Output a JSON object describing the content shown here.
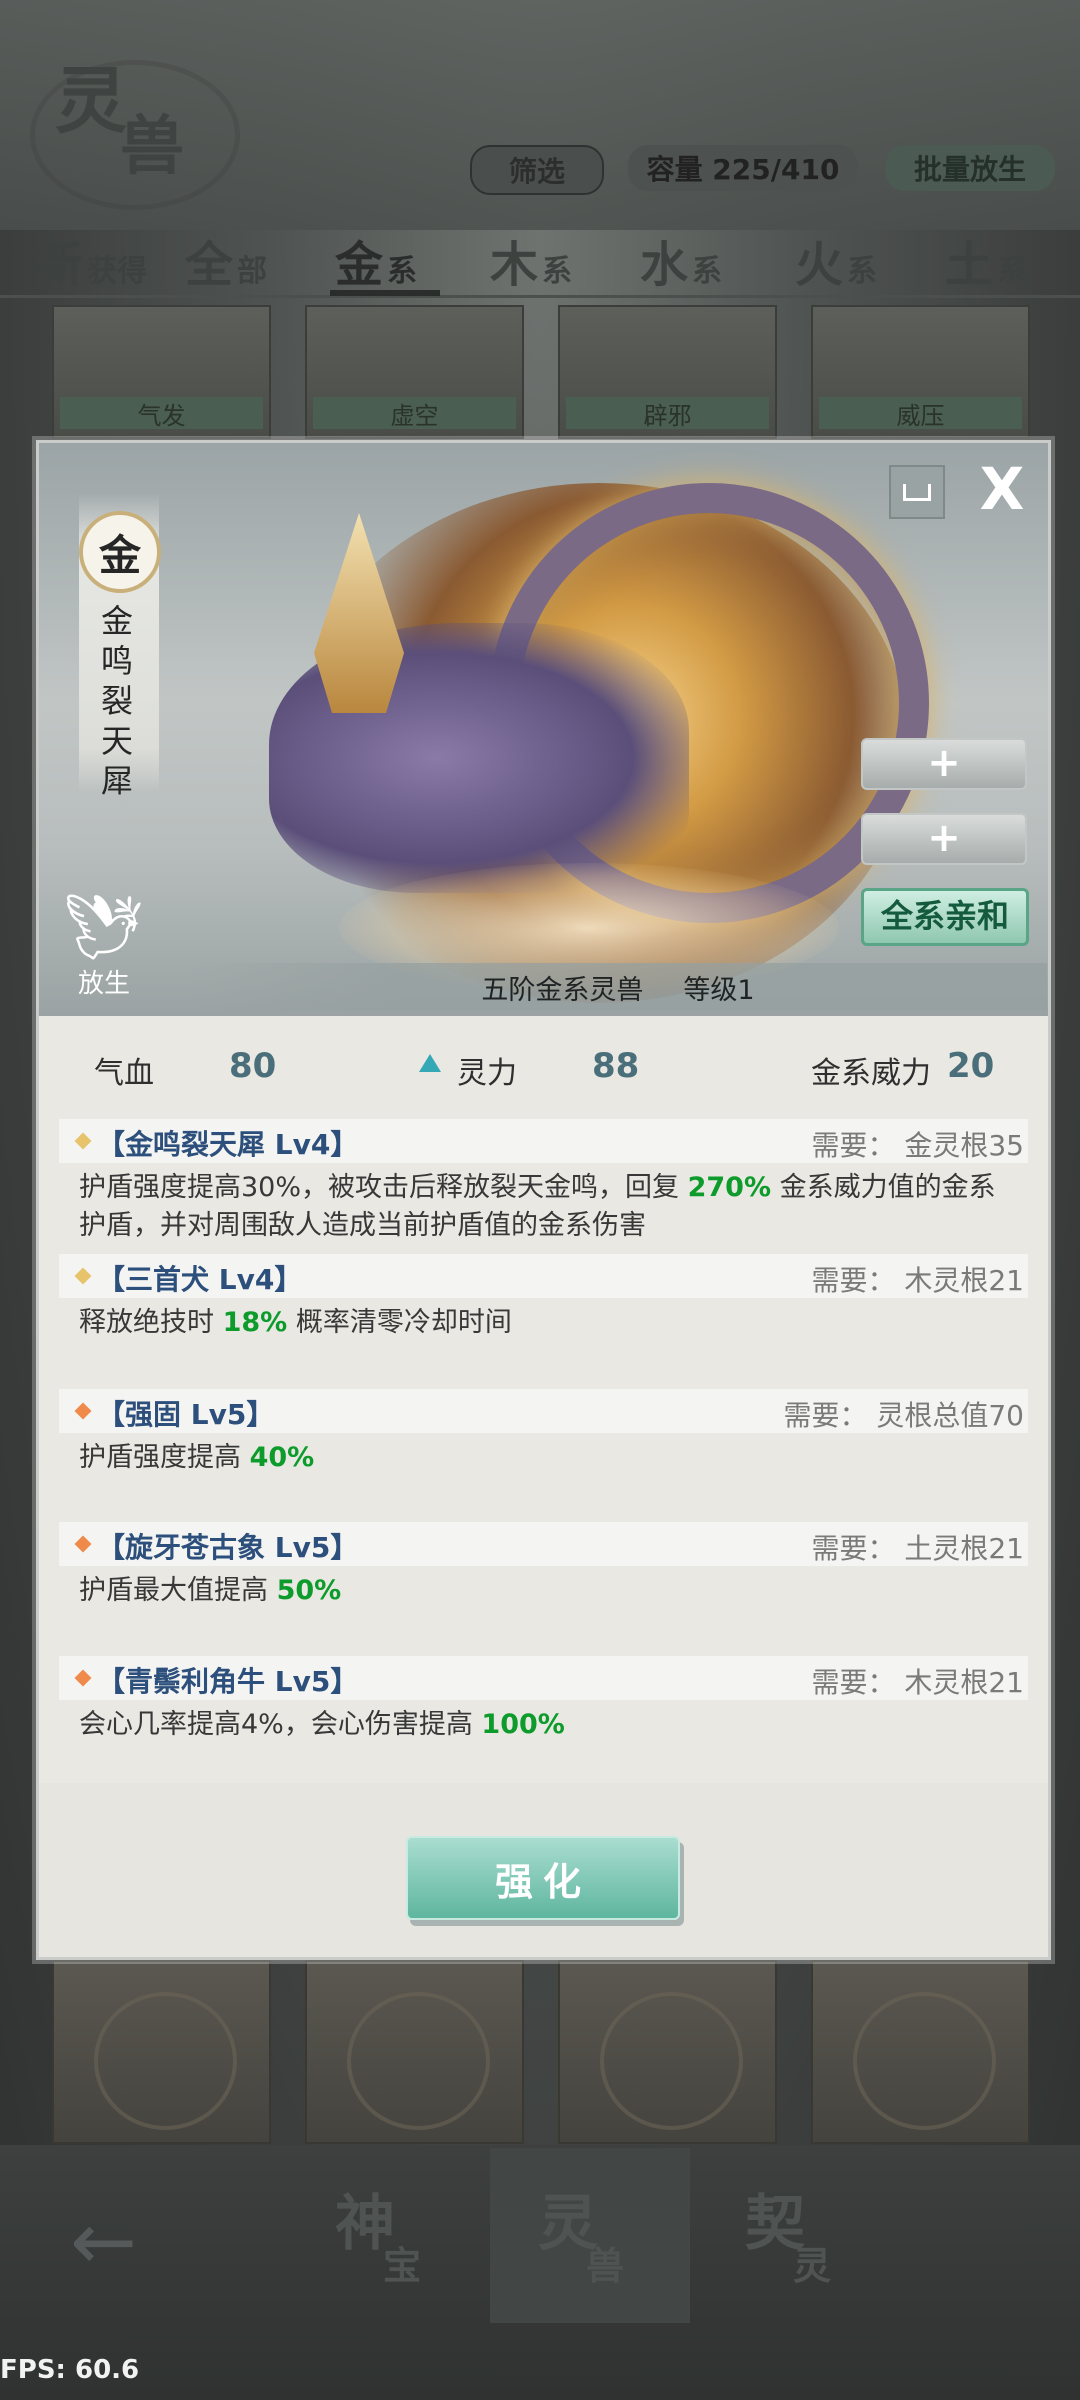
{
  "background": {
    "logo": {
      "char1": "灵",
      "char2": "兽"
    },
    "filter_label": "筛选",
    "capacity_label": "容量 225/410",
    "batch_release_label": "批量放生",
    "tabs": [
      {
        "big": "新",
        "small": "获得"
      },
      {
        "big": "全",
        "small": "部"
      },
      {
        "big": "金",
        "small": "系"
      },
      {
        "big": "木",
        "small": "系"
      },
      {
        "big": "水",
        "small": "系"
      },
      {
        "big": "火",
        "small": "系"
      },
      {
        "big": "土",
        "small": "系"
      }
    ],
    "active_tab": "金",
    "top_cards": [
      "气发",
      "虚空",
      "辟邪",
      "威压"
    ],
    "nav": [
      {
        "big": "神",
        "small": "宝"
      },
      {
        "big": "灵",
        "small": "兽"
      },
      {
        "big": "契",
        "small": "灵"
      }
    ],
    "back_label": "←",
    "fps": "FPS: 60.6"
  },
  "dialog": {
    "element_char": "金",
    "beast_name": "金鸣裂天犀",
    "release_label": "放生",
    "close_label": "X",
    "plus_label": "+",
    "affinity_label": "全系亲和",
    "rank": "五阶金系灵兽",
    "level": "等级1",
    "stats": {
      "hp_label": "气血",
      "hp_value": "80",
      "spirit_label": "灵力",
      "spirit_value": "88",
      "power_label": "金系威力",
      "power_value": "20"
    },
    "skills": [
      {
        "title": "【金鸣裂天犀 Lv4】",
        "req": "需要： 金灵根35",
        "diamond_color": "#e7c36b",
        "desc_a": "护盾强度提高30%，被攻击后释放裂天金鸣，回复 ",
        "desc_hl": "270%",
        "desc_b": " 金系威力值的金系护盾，并对周围敌人造成当前护盾值的金系伤害"
      },
      {
        "title": "【三首犬 Lv4】",
        "req": "需要： 木灵根21",
        "diamond_color": "#e7c36b",
        "desc_a": "释放绝技时 ",
        "desc_hl": "18%",
        "desc_b": " 概率清零冷却时间"
      },
      {
        "title": "【强固 Lv5】",
        "req": "需要： 灵根总值70",
        "diamond_color": "#f08a4b",
        "desc_a": "护盾强度提高 ",
        "desc_hl": "40%",
        "desc_b": ""
      },
      {
        "title": "【旋牙苍古象 Lv5】",
        "req": "需要： 土灵根21",
        "diamond_color": "#f08a4b",
        "desc_a": "护盾最大值提高 ",
        "desc_hl": "50%",
        "desc_b": ""
      },
      {
        "title": "【青鬃利角牛 Lv5】",
        "req": "需要： 木灵根21",
        "diamond_color": "#f08a4b",
        "desc_a": "会心几率提高4%，会心伤害提高 ",
        "desc_hl": "100%",
        "desc_b": ""
      }
    ],
    "strengthen_label": "强化"
  }
}
